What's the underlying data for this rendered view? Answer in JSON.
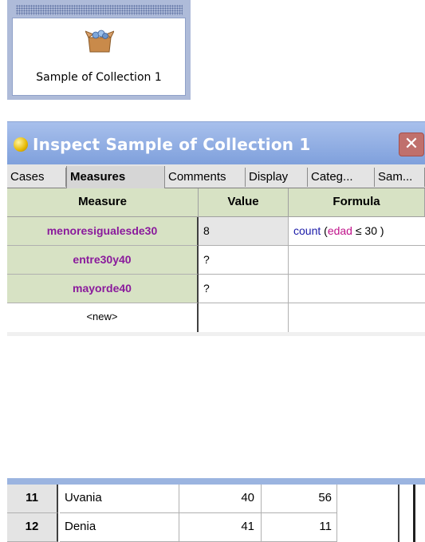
{
  "collection": {
    "label": "Sample of Collection 1",
    "icon": "open-box-icon"
  },
  "inspector": {
    "title": "Inspect Sample of Collection 1",
    "close_icon": "close-icon",
    "tabs": [
      "Cases",
      "Measures",
      "Comments",
      "Display",
      "Categ...",
      "Sam..."
    ],
    "active_tab": "Measures",
    "headers": [
      "Measure",
      "Value",
      "Formula"
    ],
    "measures": [
      {
        "name": "menoresigualesde30",
        "value": "8",
        "formula_fn": "count",
        "formula_open": " (",
        "formula_var": "edad",
        "formula_rest": " ≤ 30 )"
      },
      {
        "name": "entre30y40",
        "value": "?"
      },
      {
        "name": "mayorde40",
        "value": "?"
      }
    ],
    "new_label": "<new>"
  },
  "cases": [
    {
      "index": "11",
      "name": "Uvania",
      "v1": "40",
      "v2": "56"
    },
    {
      "index": "12",
      "name": "Denia",
      "v1": "41",
      "v2": "11"
    }
  ],
  "colors": {
    "measure_name": "#8a1a9c",
    "header_bg": "#d7e2c4",
    "titlebar": "#7fa0dc"
  }
}
